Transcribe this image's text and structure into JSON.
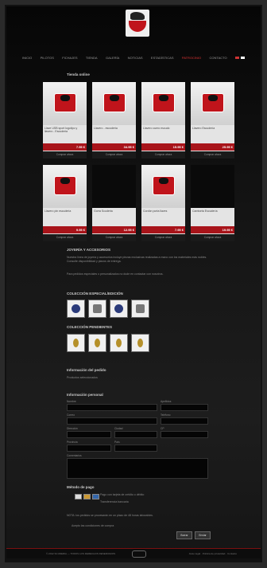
{
  "nav": {
    "items": [
      "INICIO",
      "PILOTOS",
      "FICHAJES",
      "TIENDA",
      "GALERÍA",
      "NOTICIAS",
      "ESTADÍSTICAS",
      "PATROCINIO",
      "CONTACTO"
    ],
    "active_index": 7
  },
  "store": {
    "title": "Tienda online",
    "products": [
      {
        "name": "Llave USB sport logotipo y llavero - Escuderia",
        "price": "7.95 €",
        "buy": "Comprar ahora",
        "dark": false
      },
      {
        "name": "Llavero - escuderia",
        "price": "34.95 €",
        "buy": "Comprar ahora",
        "dark": false
      },
      {
        "name": "Llavero cuero escudo",
        "price": "15.95 €",
        "buy": "Comprar ahora",
        "dark": false
      },
      {
        "name": "Llavero Escudería",
        "price": "25.95 €",
        "buy": "Comprar ahora",
        "dark": false
      },
      {
        "name": "Llavero pin escuderia",
        "price": "9.95 €",
        "buy": "Comprar ahora",
        "dark": false
      },
      {
        "name": "Gorra Scuderia",
        "price": "12.95 €",
        "buy": "Comprar ahora",
        "dark": true
      },
      {
        "name": "Cordón porta llaves",
        "price": "7.95 €",
        "buy": "Comprar ahora",
        "dark": false
      },
      {
        "name": "Camiseta Escudería",
        "price": "19.95 €",
        "buy": "Comprar ahora",
        "dark": true
      }
    ]
  },
  "jewel": {
    "title": "JOYERÍA Y ACCESORIOS",
    "p1": "Nuestra línea de joyería y accesorios incluye piezas exclusivas realizadas a mano con los materiales más nobles. Consulte disponibilidad y plazos de entrega.",
    "p2": "Para pedidos especiales o personalizados no dude en contactar con nosotros."
  },
  "col1": {
    "title": "COLECCIÓN ESPECIAL/EDICIÓN"
  },
  "col2": {
    "title": "COLECCIÓN PENDIENTES"
  },
  "info": {
    "title": "Información del pedido",
    "text": "Productos seleccionados"
  },
  "form": {
    "title": "Información personal",
    "name": "Nombre",
    "surname": "Apellidos",
    "email": "Correo",
    "phone": "Teléfono",
    "street": "Dirección",
    "city": "Ciudad",
    "zip": "CP",
    "province": "Provincia",
    "country": "País",
    "comments": "Comentarios"
  },
  "payment": {
    "title": "Método de pago",
    "opt1": "Pago con tarjeta de crédito o débito",
    "opt2": "Transferencia bancaria",
    "note": "NOTA: los pedidos se procesarán en un plazo de 48 horas laborables.",
    "check": "Acepto las condiciones de compra"
  },
  "buttons": {
    "reset": "Borrar",
    "send": "Enviar"
  },
  "footer": {
    "left": "© 2012 SCUDERIA — TODOS LOS DERECHOS RESERVADOS",
    "right": "Aviso legal · Política de privacidad · Contacto"
  }
}
